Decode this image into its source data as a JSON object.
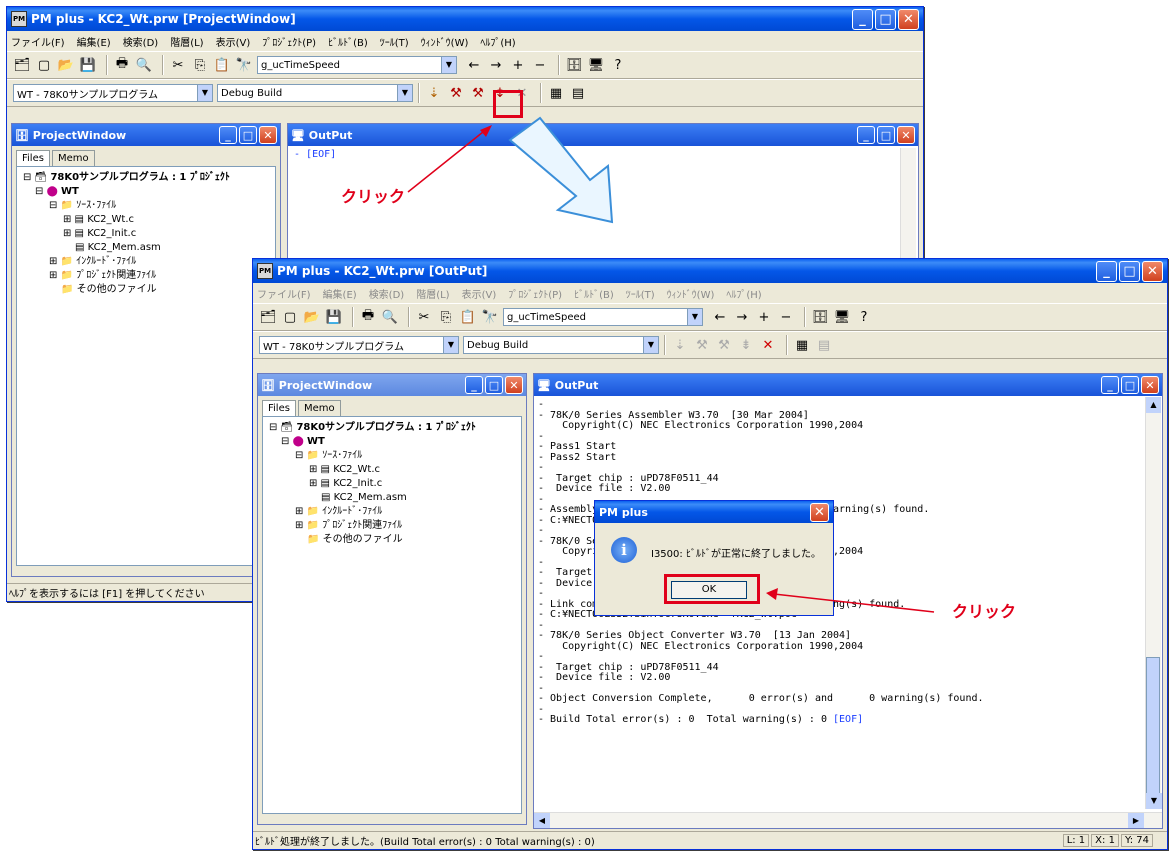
{
  "back_window": {
    "title": "PM plus - KC2_Wt.prw [ProjectWindow]",
    "menu": [
      "ファイル(F)",
      "編集(E)",
      "検索(D)",
      "階層(L)",
      "表示(V)",
      "ﾌﾟﾛｼﾞｪｸﾄ(P)",
      "ﾋﾞﾙﾄﾞ(B)",
      "ﾂｰﾙ(T)",
      "ｳｨﾝﾄﾞｳ(W)",
      "ﾍﾙﾌﾟ(H)"
    ],
    "search_combo": "g_ucTimeSpeed",
    "project_combo": "WT - 78K0サンプルプログラム",
    "build_combo": "Debug Build",
    "project_window_title": "ProjectWindow",
    "output_title": "OutPut",
    "output_text": "[EOF]",
    "status": "ﾍﾙﾌﾟを表示するには [F1] を押してください"
  },
  "tabs": [
    "Files",
    "Memo"
  ],
  "tree": {
    "root": "78K0サンプルプログラム : 1 ﾌﾟﾛｼﾞｪｸﾄ",
    "wt": "WT",
    "sources": "ｿｰｽ･ﾌｧｲﾙ",
    "files": [
      "KC2_Wt.c",
      "KC2_Init.c",
      "KC2_Mem.asm"
    ],
    "include": "ｲﾝｸﾙｰﾄﾞ･ﾌｧｲﾙ",
    "project_related": "ﾌﾟﾛｼﾞｪｸﾄ関連ﾌｧｲﾙ",
    "other": "その他のファイル"
  },
  "front_window": {
    "title": "PM plus - KC2_Wt.prw [OutPut]",
    "search_combo": "g_ucTimeSpeed",
    "project_combo": "WT - 78K0サンプルプログラム",
    "build_combo": "Debug Build",
    "project_window_title": "ProjectWindow",
    "output_title": "OutPut",
    "output_lines": [
      "-",
      "- 78K/0 Series Assembler W3.70  [30 Mar 2004]",
      "    Copyright(C) NEC Electronics Corporation 1990,2004",
      "-",
      "- Pass1 Start",
      "- Pass2 Start",
      "-",
      "-  Target chip : uPD78F0511_44",
      "-  Device file : V2.00",
      "-",
      "- Assembly complete,      0 error(s) and      0 warning(s) found.",
      "- C:¥NECTOOLS32¥bin¥lk78K0.exe",
      "-",
      "- 78K/0 Series Linker W3.70  [13 Jan 2004]",
      "    Copyright(C) NEC Electronics Corporation 1990,2004",
      "-",
      "-  Target chip : uPD78F0511_44",
      "-  Device file : V2.00",
      "-",
      "- Link complete,      0 error(s) and      0 warning(s) found.",
      "- C:¥NECTOOLS32¥bin¥oc78K0.exe -fKC2_Wt.poc",
      "-",
      "- 78K/0 Series Object Converter W3.70  [13 Jan 2004]",
      "    Copyright(C) NEC Electronics Corporation 1990,2004",
      "-",
      "-  Target chip : uPD78F0511_44",
      "-  Device file : V2.00",
      "-",
      "- Object Conversion Complete,      0 error(s) and      0 warning(s) found.",
      "-",
      "- Build Total error(s) : 0  Total warning(s) : 0 "
    ],
    "eof": "[EOF]",
    "status": "ﾋﾞﾙﾄﾞ処理が終了しました。(Build Total error(s) : 0  Total warning(s) : 0)",
    "status_pos": [
      "L: 1",
      "X: 1",
      "Y: 74"
    ]
  },
  "dialog": {
    "title": "PM plus",
    "message": "I3500: ﾋﾞﾙﾄﾞが正常に終了しました。",
    "ok": "OK"
  },
  "annotations": {
    "click1": "クリック",
    "click2": "クリック"
  },
  "colors": {
    "annotation_red": "#e0001a",
    "title_blue": "#0a5ff0"
  }
}
